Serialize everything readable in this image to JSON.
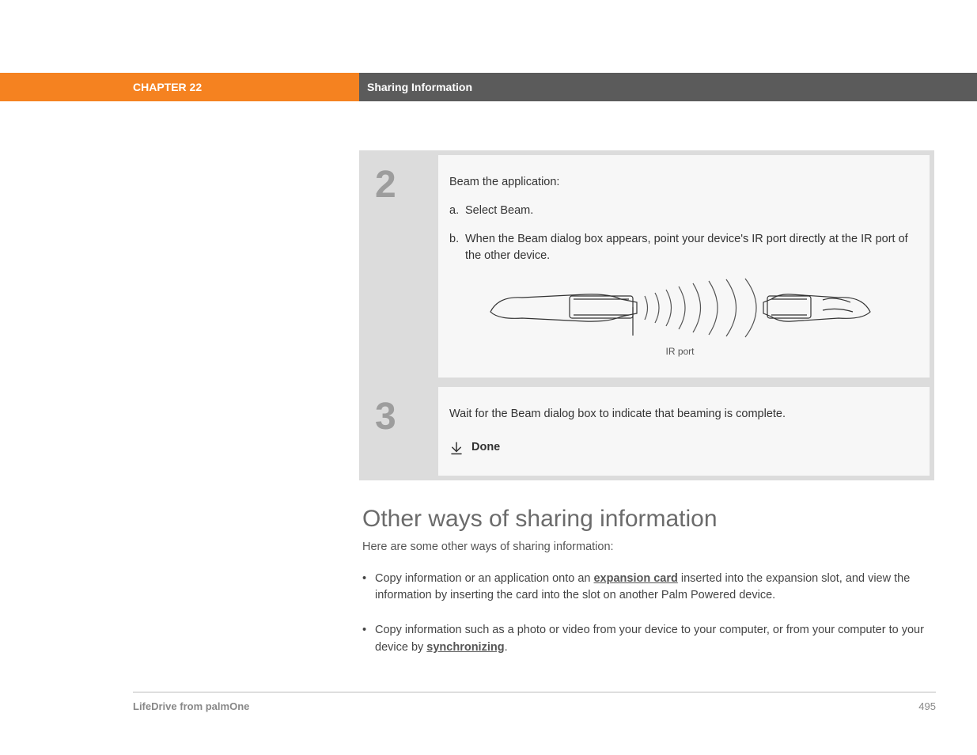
{
  "header": {
    "chapter": "CHAPTER 22",
    "title": "Sharing Information"
  },
  "steps": {
    "step2": {
      "num": "2",
      "intro": "Beam the application:",
      "a_letter": "a.",
      "a_text": "Select Beam.",
      "b_letter": "b.",
      "b_text": "When the Beam dialog box appears, point your device's IR port directly at the IR port of the other device.",
      "ir_label": "IR port"
    },
    "step3": {
      "num": "3",
      "text": "Wait for the Beam dialog box to indicate that beaming is complete.",
      "done": "Done"
    }
  },
  "section": {
    "title": "Other ways of sharing information",
    "intro": "Here are some other ways of sharing information:",
    "bullet1_pre": "Copy information or an application onto an ",
    "bullet1_link": "expansion card",
    "bullet1_post": " inserted into the expansion slot, and view the information by inserting the card into the slot on another Palm Powered device.",
    "bullet2_pre": "Copy information such as a photo or video from your device to your computer, or from your computer to your device by ",
    "bullet2_link": "synchronizing",
    "bullet2_post": "."
  },
  "footer": {
    "product": "LifeDrive from palmOne",
    "page": "495"
  }
}
